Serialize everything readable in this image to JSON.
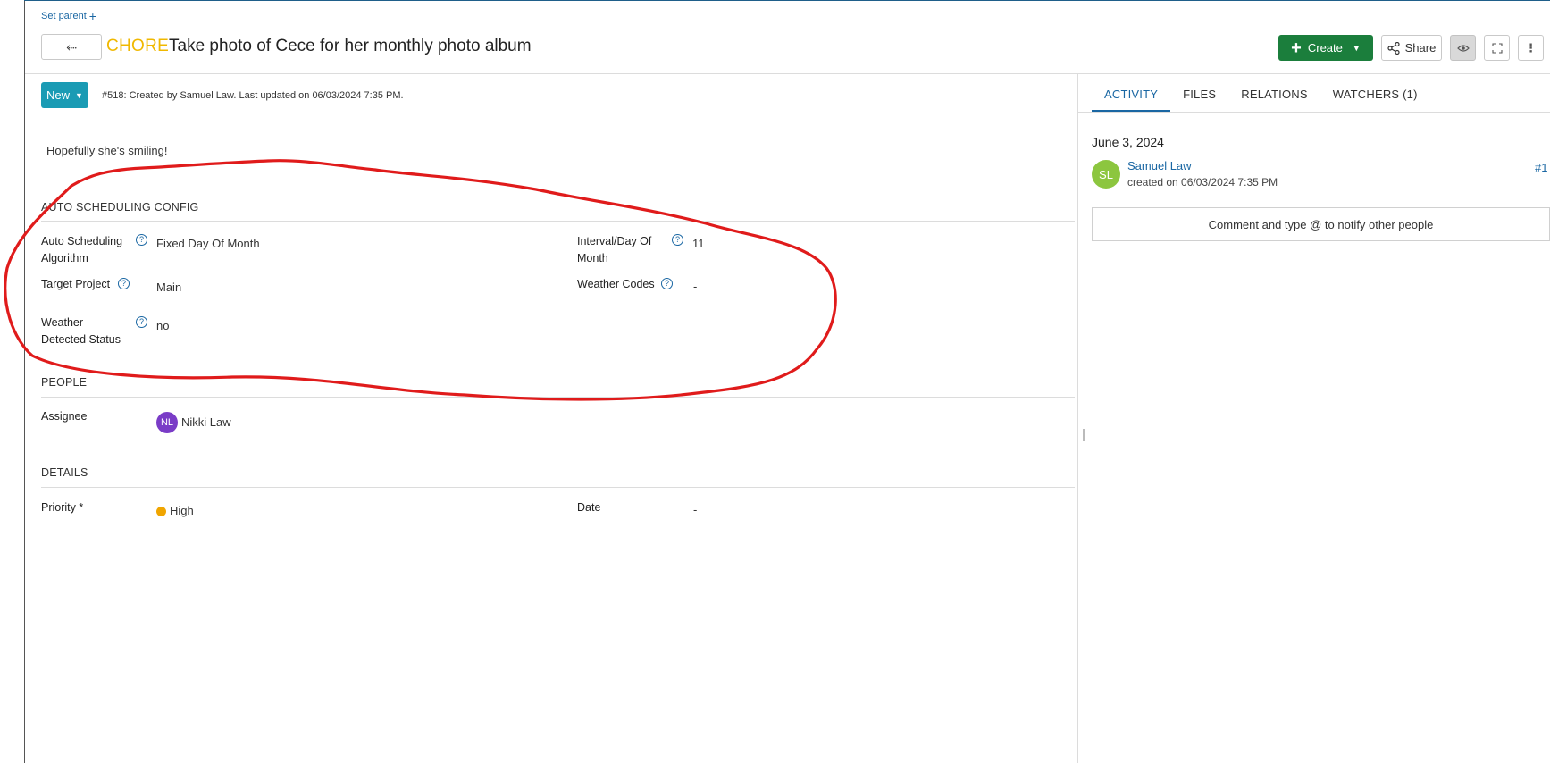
{
  "header": {
    "set_parent_label": "Set parent",
    "set_parent_plus": "+",
    "back_glyph": "⬸",
    "type_label": "CHORE",
    "title": "Take photo of Cece for her monthly photo album",
    "create_label": "Create",
    "share_label": "Share"
  },
  "status": {
    "label": "New",
    "meta": "#518: Created by Samuel Law. Last updated on 06/03/2024 7:35 PM."
  },
  "description": "Hopefully she's smiling!",
  "auto_scheduling": {
    "section_title": "AUTO SCHEDULING CONFIG",
    "algorithm_label_line1": "Auto Scheduling",
    "algorithm_label_line2": "Algorithm",
    "algorithm_value": "Fixed Day Of Month",
    "interval_label_line1": "Interval/Day Of",
    "interval_label_line2": "Month",
    "interval_value": "11",
    "target_project_label": "Target Project",
    "target_project_value": "Main",
    "weather_codes_label": "Weather Codes",
    "weather_codes_value": "-",
    "weather_status_label_line1": "Weather",
    "weather_status_label_line2": "Detected Status",
    "weather_status_value": "no"
  },
  "people": {
    "section_title": "PEOPLE",
    "assignee_label": "Assignee",
    "assignee_initials": "NL",
    "assignee_name": "Nikki Law"
  },
  "details": {
    "section_title": "DETAILS",
    "priority_label": "Priority *",
    "priority_value": "High",
    "date_label": "Date",
    "date_value": "-"
  },
  "activity": {
    "tabs": [
      "ACTIVITY",
      "FILES",
      "RELATIONS",
      "WATCHERS (1)"
    ],
    "date": "June 3, 2024",
    "user_initials": "SL",
    "user_name": "Samuel Law",
    "action": "created on 06/03/2024 7:35 PM",
    "ref": "#1",
    "comment_placeholder": "Comment and type @ to notify other people"
  },
  "colors": {
    "accent_blue": "#1a67a3",
    "create_green": "#1b7e3c",
    "status_teal": "#1a9bb4",
    "chore_yellow": "#f0b800",
    "priority_high": "#f0a500",
    "annotation_red": "#e01b1b"
  }
}
